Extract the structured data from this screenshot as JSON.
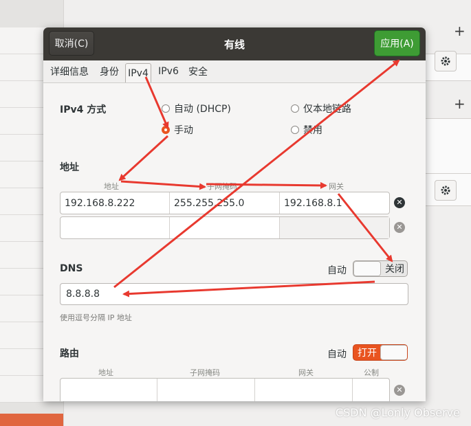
{
  "dialog": {
    "title": "有线",
    "cancel_label": "取消(C)",
    "apply_label": "应用(A)"
  },
  "tabs": [
    "详细信息",
    "身份",
    "IPv4",
    "IPv6",
    "安全"
  ],
  "active_tab": "IPv4",
  "ipv4": {
    "method_label": "IPv4 方式",
    "methods": {
      "auto_dhcp": "自动 (DHCP)",
      "link_local": "仅本地链路",
      "manual": "手动",
      "disabled": "禁用"
    },
    "selected_method": "manual"
  },
  "addresses": {
    "section_label": "地址",
    "columns": [
      "地址",
      "子网掩码",
      "网关"
    ],
    "rows": [
      [
        "192.168.8.222",
        "255.255.255.0",
        "192.168.8.1"
      ],
      [
        "",
        "",
        ""
      ]
    ]
  },
  "dns": {
    "label": "DNS",
    "auto_label": "自动",
    "switch_label": "关闭",
    "value": "8.8.8.8",
    "hint": "使用逗号分隔 IP 地址"
  },
  "routes": {
    "label": "路由",
    "auto_label": "自动",
    "switch_label": "打开",
    "columns": [
      "地址",
      "子网掩码",
      "网关",
      "公制"
    ]
  },
  "watermark": "CSDN @Lonly Observe",
  "colors": {
    "accent": "#e95420",
    "apply_green": "#3e9c34",
    "titlebar": "#3b3935",
    "annotation_red": "#e8392f"
  }
}
